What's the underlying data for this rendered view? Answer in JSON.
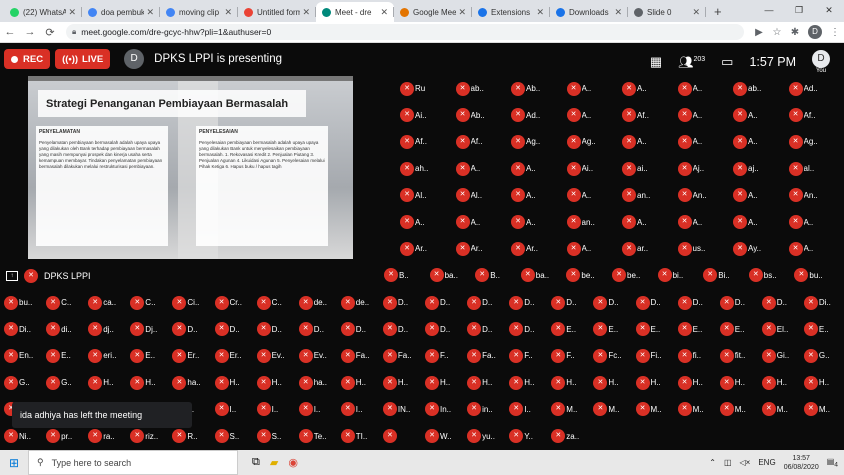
{
  "browser": {
    "tabs": [
      {
        "label": "(22) WhatsApp",
        "color": "#25d366"
      },
      {
        "label": "doa pembuka",
        "color": "#4285f4"
      },
      {
        "label": "moving clip",
        "color": "#4285f4"
      },
      {
        "label": "Untitled form",
        "color": "#ea4335"
      },
      {
        "label": "Meet - dre",
        "color": "#00897b",
        "active": true
      },
      {
        "label": "Google Meet",
        "color": "#e37400"
      },
      {
        "label": "Extensions",
        "color": "#1a73e8"
      },
      {
        "label": "Downloads",
        "color": "#1a73e8"
      },
      {
        "label": "Slide 0",
        "color": "#5f6368"
      }
    ],
    "url": "meet.google.com/dre-gcyc-hhw?pli=1&authuser=0",
    "profile_initial": "D"
  },
  "meet": {
    "rec_label": "REC",
    "live_label": "LIVE",
    "presenter_initial": "D",
    "presenting_text": "DPKS LPPI is presenting",
    "participant_count": "203",
    "clock": "1:57 PM",
    "self_initial": "D",
    "self_label": "You"
  },
  "slide": {
    "title": "Strategi Penanganan Pembiayaan Bermasalah",
    "left_heading": "PENYELAMATAN",
    "left_text": "Penyelamatan pembiayaan bermasalah adalah upaya upaya yang dilakukan oleh Bank terhadap pembiayaan bermasalah yang masih mempunyai prospek dan kinerja usaha serta kemampuan membayar. Tindakan penyelamatan pembiayaan bermasalah dilakukan melalui restrukturisasi pembiayaan.",
    "right_heading": "PENYELESAIAN",
    "right_text": "Penyelesaian pembiayaan bermasalah adalah upaya upaya yang dilakukan Bank untuk menyelesaikan pembiayaan bermasalah. 1. Rekovasasi Kredit 2. Penjualan Piutang 3. Penjualan Agunan 4. Likuidasi Agunan 5. Penyelesaian melalui Pihak Ketiga 6. Hapus buku / hapus tagih"
  },
  "presenter_bar": {
    "name": "DPKS LPPI"
  },
  "toast": "ida adhiya has left the meeting",
  "participants": {
    "right_rows": [
      [
        "Ru",
        "ab..",
        "Ab..",
        "A..",
        "A..",
        "A..",
        "ab..",
        "Ad.."
      ],
      [
        "Ai..",
        "Ab..",
        "Ad..",
        "A..",
        "Af..",
        "A..",
        "A..",
        "Af.."
      ],
      [
        "Af..",
        "Af..",
        "Ag..",
        "Ag..",
        "A..",
        "A..",
        "A..",
        "Ag.."
      ],
      [
        "ah..",
        "A..",
        "A..",
        "Ai..",
        "ai..",
        "Aj..",
        "aj..",
        "al.."
      ],
      [
        "Al..",
        "Al..",
        "A..",
        "A..",
        "an..",
        "An..",
        "A..",
        "An.."
      ],
      [
        "A..",
        "A..",
        "A..",
        "an..",
        "A..",
        "A..",
        "A..",
        "A.."
      ],
      [
        "Ar..",
        "Ar..",
        "Ar..",
        "A..",
        "ar..",
        "us..",
        "Ay..",
        "A.."
      ],
      [
        "B..",
        "ba..",
        "B..",
        "ba..",
        "be..",
        "be..",
        "bi..",
        "Bi..",
        "bs..",
        "bu.."
      ]
    ],
    "full_rows": [
      [
        "bu..",
        "C..",
        "ca..",
        "C..",
        "Ci..",
        "Cr..",
        "C..",
        "de..",
        "de..",
        "D..",
        "D..",
        "D..",
        "D..",
        "D..",
        "D..",
        "D..",
        "D..",
        "D..",
        "D..",
        "Di.."
      ],
      [
        "Di..",
        "di..",
        "dj..",
        "Dj..",
        "D..",
        "D..",
        "D..",
        "D..",
        "D..",
        "D..",
        "D..",
        "D..",
        "D..",
        "E..",
        "E..",
        "E..",
        "E..",
        "E..",
        "El..",
        "E.."
      ],
      [
        "En..",
        "E..",
        "eri..",
        "E..",
        "Er..",
        "Er..",
        "Ev..",
        "Ev..",
        "Fa..",
        "Fa..",
        "F..",
        "Fa..",
        "F..",
        "F..",
        "Fc..",
        "Fi..",
        "fi..",
        "fit..",
        "Gi..",
        "G.."
      ],
      [
        "G..",
        "G..",
        "H..",
        "H..",
        "ha..",
        "H..",
        "H..",
        "ha..",
        "H..",
        "H..",
        "H..",
        "H..",
        "H..",
        "H..",
        "H..",
        "H..",
        "H..",
        "H..",
        "H..",
        "H.."
      ],
      [
        "I..",
        "I..",
        "I..",
        "I..",
        "I..",
        "I..",
        "I..",
        "I..",
        "I..",
        "IN..",
        "In..",
        "in..",
        "I..",
        "M..",
        "M..",
        "M..",
        "M..",
        "M..",
        "M..",
        "M.."
      ],
      [
        "Ni..",
        "pr..",
        "ra..",
        "riz..",
        "R..",
        "S..",
        "S..",
        "Te..",
        "TI..",
        "",
        "W..",
        "yu..",
        "Y..",
        "za.."
      ]
    ]
  },
  "taskbar": {
    "search_placeholder": "Type here to search",
    "lang": "ENG",
    "time": "13:57",
    "date": "06/08/2020",
    "notif_count": "4"
  }
}
